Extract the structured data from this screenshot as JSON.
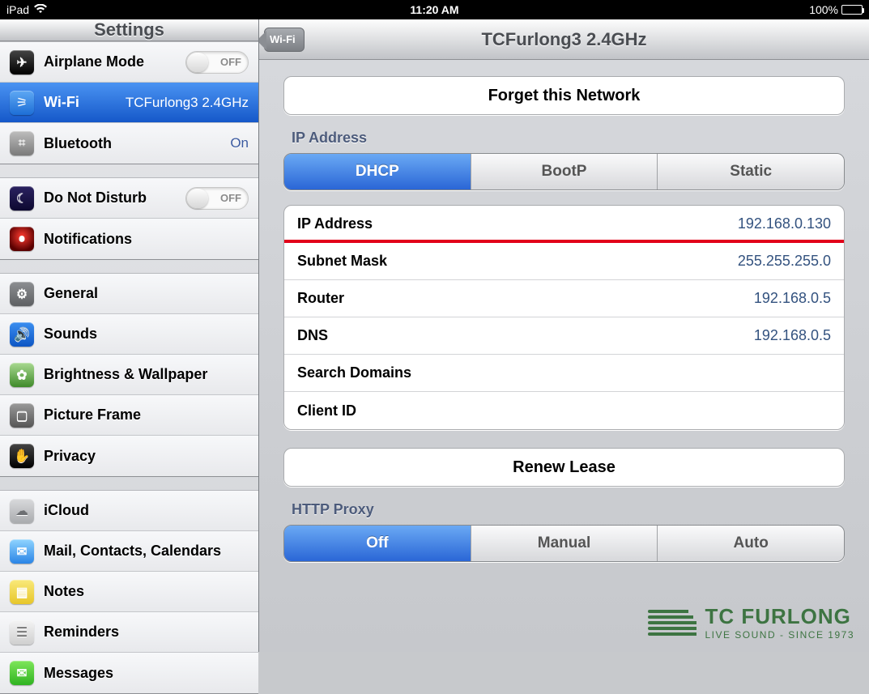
{
  "statusbar": {
    "device": "iPad",
    "time": "11:20 AM",
    "battery_pct": "100%"
  },
  "sidebar": {
    "title": "Settings",
    "groups": [
      {
        "rows": [
          {
            "icon": "airplane",
            "label": "Airplane Mode",
            "toggle": "OFF"
          },
          {
            "icon": "wifi",
            "label": "Wi-Fi",
            "value": "TCFurlong3 2.4GHz",
            "selected": true
          },
          {
            "icon": "bt",
            "label": "Bluetooth",
            "value": "On"
          }
        ]
      },
      {
        "rows": [
          {
            "icon": "dnd",
            "label": "Do Not Disturb",
            "toggle": "OFF"
          },
          {
            "icon": "notif",
            "label": "Notifications"
          }
        ]
      },
      {
        "rows": [
          {
            "icon": "gear",
            "label": "General"
          },
          {
            "icon": "sound",
            "label": "Sounds"
          },
          {
            "icon": "bright",
            "label": "Brightness & Wallpaper"
          },
          {
            "icon": "frame",
            "label": "Picture Frame"
          },
          {
            "icon": "priv",
            "label": "Privacy"
          }
        ]
      },
      {
        "rows": [
          {
            "icon": "cloud",
            "label": "iCloud"
          },
          {
            "icon": "mail",
            "label": "Mail, Contacts, Calendars"
          },
          {
            "icon": "notes",
            "label": "Notes"
          },
          {
            "icon": "rem",
            "label": "Reminders"
          },
          {
            "icon": "msg",
            "label": "Messages"
          }
        ]
      }
    ]
  },
  "detail": {
    "back": "Wi-Fi",
    "title": "TCFurlong3 2.4GHz",
    "forget": "Forget this Network",
    "ip_section": "IP Address",
    "ip_tabs": [
      "DHCP",
      "BootP",
      "Static"
    ],
    "ip_tab_active": 0,
    "ip_rows": [
      {
        "k": "IP Address",
        "v": "192.168.0.130",
        "hl": true
      },
      {
        "k": "Subnet Mask",
        "v": "255.255.255.0"
      },
      {
        "k": "Router",
        "v": "192.168.0.5"
      },
      {
        "k": "DNS",
        "v": "192.168.0.5"
      },
      {
        "k": "Search Domains",
        "v": ""
      },
      {
        "k": "Client ID",
        "v": ""
      }
    ],
    "renew": "Renew Lease",
    "proxy_section": "HTTP Proxy",
    "proxy_tabs": [
      "Off",
      "Manual",
      "Auto"
    ],
    "proxy_tab_active": 0
  },
  "watermark": {
    "big": "TC FURLONG",
    "small": "LIVE SOUND - SINCE 1973"
  },
  "icons": {
    "airplane": "✈",
    "wifi": "⚞",
    "bt": "⌗",
    "dnd": "☾",
    "notif": "●",
    "gear": "⚙",
    "sound": "🔊",
    "bright": "✿",
    "frame": "▢",
    "priv": "✋",
    "cloud": "☁",
    "mail": "✉",
    "notes": "▤",
    "rem": "☰",
    "msg": "✉"
  }
}
